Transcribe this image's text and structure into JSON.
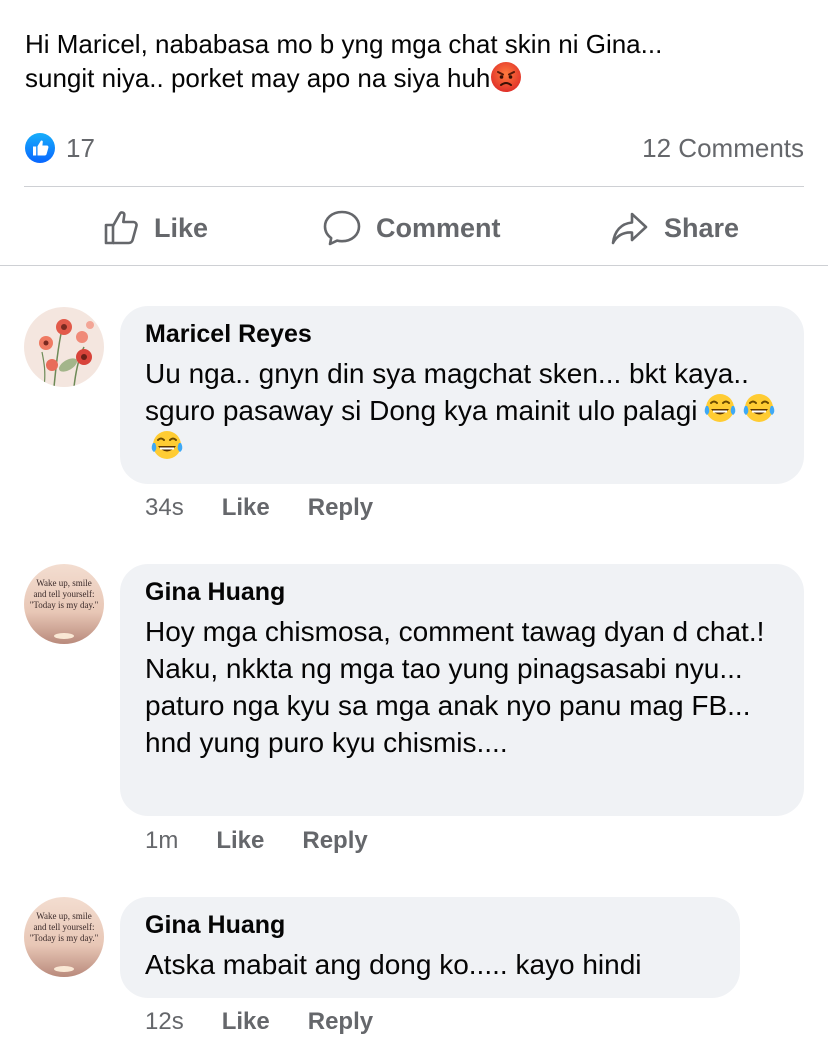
{
  "post": {
    "text_line1": "Hi Maricel, nababasa mo b yng mga chat skin ni Gina...",
    "text_line2": "sungit niya.. porket may apo na siya huh",
    "emoji": "angry-face-emoji"
  },
  "stats": {
    "reaction_icon": "like-icon",
    "reactions_count": "17",
    "comments_label": "12 Comments"
  },
  "actions": {
    "like_label": "Like",
    "comment_label": "Comment",
    "share_label": "Share"
  },
  "comments": [
    {
      "author": "Maricel Reyes",
      "text": "Uu nga.. gnyn din sya magchat sken... bkt kaya.. sguro pasaway si Dong kya mainit ulo palagi",
      "emoji": "laughing-tears-emoji x3",
      "time": "34s",
      "like_label": "Like",
      "reply_label": "Reply"
    },
    {
      "author": "Gina Huang",
      "text": "Hoy mga chismosa, comment tawag dyan d chat.! Naku, nkkta ng mga tao yung pinagsasabi nyu... paturo nga kyu sa mga anak nyo panu mag FB... hnd yung puro kyu chismis....",
      "time": "1m",
      "like_label": "Like",
      "reply_label": "Reply"
    },
    {
      "author": "Gina Huang",
      "text": "Atska mabait ang dong ko..... kayo hindi",
      "time": "12s",
      "like_label": "Like",
      "reply_label": "Reply"
    }
  ],
  "avatar_text": {
    "line1": "Wake up, smile",
    "line2": "and tell yourself:",
    "line3": "\"Today is my day.\""
  },
  "colors": {
    "like_blue": "#1877f2",
    "secondary_text": "#65676b",
    "bubble_bg": "#f0f2f5"
  }
}
